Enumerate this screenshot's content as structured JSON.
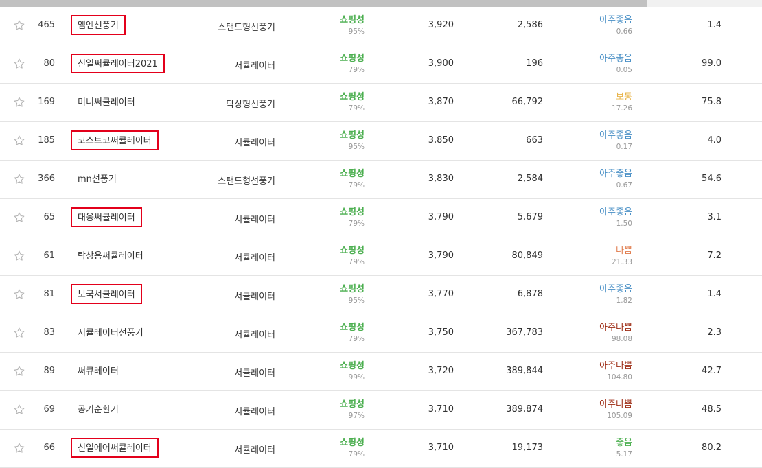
{
  "colors": {
    "highlight_border": "#e3001b",
    "shopping": "#4caf50",
    "very_good": "#4a90c6",
    "normal": "#e8b44a",
    "bad": "#e07a4a",
    "very_bad": "#9c2a12",
    "good": "#4caf50"
  },
  "rows": [
    {
      "rank": "465",
      "keyword": "엠엔선풍기",
      "highlighted": true,
      "category": "스탠드형선풍기",
      "tag": "쇼핑성",
      "tag_pct": "95%",
      "search": "3,920",
      "products": "2,586",
      "competition": "아주좋음",
      "competition_level": "very_good",
      "competition_value": "0.66",
      "last": "1.4"
    },
    {
      "rank": "80",
      "keyword": "신일써큘레이터2021",
      "highlighted": true,
      "category": "서큘레이터",
      "tag": "쇼핑성",
      "tag_pct": "79%",
      "search": "3,900",
      "products": "196",
      "competition": "아주좋음",
      "competition_level": "very_good",
      "competition_value": "0.05",
      "last": "99.0"
    },
    {
      "rank": "169",
      "keyword": "미니써큘레이터",
      "highlighted": false,
      "category": "탁상형선풍기",
      "tag": "쇼핑성",
      "tag_pct": "79%",
      "search": "3,870",
      "products": "66,792",
      "competition": "보통",
      "competition_level": "normal",
      "competition_value": "17.26",
      "last": "75.8"
    },
    {
      "rank": "185",
      "keyword": "코스트코써큘레이터",
      "highlighted": true,
      "category": "서큘레이터",
      "tag": "쇼핑성",
      "tag_pct": "95%",
      "search": "3,850",
      "products": "663",
      "competition": "아주좋음",
      "competition_level": "very_good",
      "competition_value": "0.17",
      "last": "4.0"
    },
    {
      "rank": "366",
      "keyword": "mn선풍기",
      "highlighted": false,
      "category": "스탠드형선풍기",
      "tag": "쇼핑성",
      "tag_pct": "79%",
      "search": "3,830",
      "products": "2,584",
      "competition": "아주좋음",
      "competition_level": "very_good",
      "competition_value": "0.67",
      "last": "54.6"
    },
    {
      "rank": "65",
      "keyword": "대웅써큘레이터",
      "highlighted": true,
      "category": "서큘레이터",
      "tag": "쇼핑성",
      "tag_pct": "79%",
      "search": "3,790",
      "products": "5,679",
      "competition": "아주좋음",
      "competition_level": "very_good",
      "competition_value": "1.50",
      "last": "3.1"
    },
    {
      "rank": "61",
      "keyword": "탁상용써큘레이터",
      "highlighted": false,
      "category": "서큘레이터",
      "tag": "쇼핑성",
      "tag_pct": "79%",
      "search": "3,790",
      "products": "80,849",
      "competition": "나쁨",
      "competition_level": "bad",
      "competition_value": "21.33",
      "last": "7.2"
    },
    {
      "rank": "81",
      "keyword": "보국서큘레이터",
      "highlighted": true,
      "category": "서큘레이터",
      "tag": "쇼핑성",
      "tag_pct": "95%",
      "search": "3,770",
      "products": "6,878",
      "competition": "아주좋음",
      "competition_level": "very_good",
      "competition_value": "1.82",
      "last": "1.4"
    },
    {
      "rank": "83",
      "keyword": "서큘레이터선풍기",
      "highlighted": false,
      "category": "서큘레이터",
      "tag": "쇼핑성",
      "tag_pct": "79%",
      "search": "3,750",
      "products": "367,783",
      "competition": "아주나쁨",
      "competition_level": "very_bad",
      "competition_value": "98.08",
      "last": "2.3"
    },
    {
      "rank": "89",
      "keyword": "써큐레이터",
      "highlighted": false,
      "category": "서큘레이터",
      "tag": "쇼핑성",
      "tag_pct": "99%",
      "search": "3,720",
      "products": "389,844",
      "competition": "아주나쁨",
      "competition_level": "very_bad",
      "competition_value": "104.80",
      "last": "42.7"
    },
    {
      "rank": "69",
      "keyword": "공기순환기",
      "highlighted": false,
      "category": "서큘레이터",
      "tag": "쇼핑성",
      "tag_pct": "97%",
      "search": "3,710",
      "products": "389,874",
      "competition": "아주나쁨",
      "competition_level": "very_bad",
      "competition_value": "105.09",
      "last": "48.5"
    },
    {
      "rank": "66",
      "keyword": "신일에어써큘레이터",
      "highlighted": true,
      "category": "서큘레이터",
      "tag": "쇼핑성",
      "tag_pct": "79%",
      "search": "3,710",
      "products": "19,173",
      "competition": "좋음",
      "competition_level": "good",
      "competition_value": "5.17",
      "last": "80.2"
    }
  ]
}
